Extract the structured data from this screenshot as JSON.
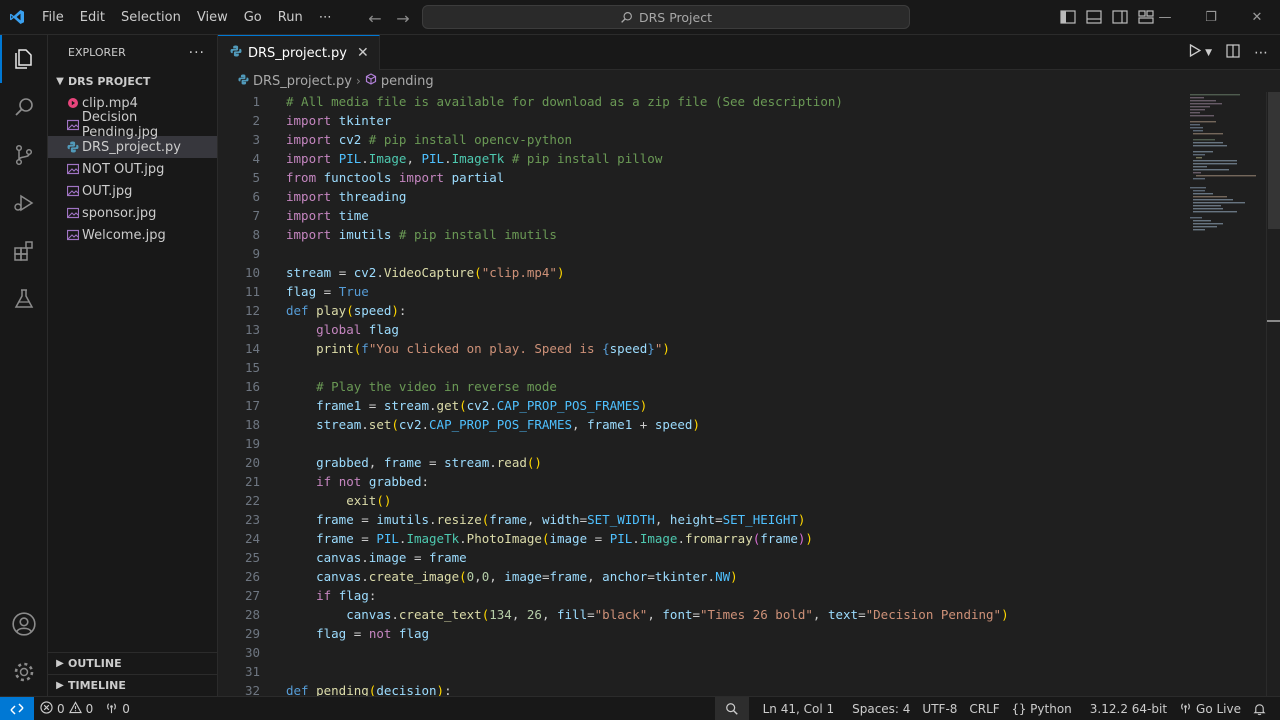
{
  "titlebar": {
    "menu": [
      "File",
      "Edit",
      "Selection",
      "View",
      "Go",
      "Run",
      "⋯"
    ],
    "search_text": "DRS Project"
  },
  "sidebar": {
    "title": "EXPLORER",
    "more": "···",
    "project": "DRS PROJECT",
    "files": [
      {
        "name": "clip.mp4",
        "type": "video"
      },
      {
        "name": "Decision Pending.jpg",
        "type": "image"
      },
      {
        "name": "DRS_project.py",
        "type": "python",
        "selected": true
      },
      {
        "name": "NOT OUT.jpg",
        "type": "image"
      },
      {
        "name": "OUT.jpg",
        "type": "image"
      },
      {
        "name": "sponsor.jpg",
        "type": "image"
      },
      {
        "name": "Welcome.jpg",
        "type": "image"
      }
    ],
    "outline": "OUTLINE",
    "timeline": "TIMELINE"
  },
  "editor": {
    "tab_label": "DRS_project.py",
    "breadcrumb_file": "DRS_project.py",
    "breadcrumb_symbol": "pending",
    "line_numbers": [
      "1",
      "2",
      "3",
      "4",
      "5",
      "6",
      "7",
      "8",
      "9",
      "10",
      "11",
      "12",
      "13",
      "14",
      "15",
      "16",
      "17",
      "18",
      "19",
      "20",
      "21",
      "22",
      "23",
      "24",
      "25",
      "26",
      "27",
      "28",
      "29",
      "30",
      "31",
      "32"
    ],
    "code": [
      "# All media file is available for download as a zip file (See description)",
      "import tkinter",
      "import cv2 # pip install opencv-python",
      "import PIL.Image, PIL.ImageTk # pip install pillow",
      "from functools import partial",
      "import threading",
      "import time",
      "import imutils # pip install imutils",
      "",
      "stream = cv2.VideoCapture(\"clip.mp4\")",
      "flag = True",
      "def play(speed):",
      "    global flag",
      "    print(f\"You clicked on play. Speed is {speed}\")",
      "",
      "    # Play the video in reverse mode",
      "    frame1 = stream.get(cv2.CAP_PROP_POS_FRAMES)",
      "    stream.set(cv2.CAP_PROP_POS_FRAMES, frame1 + speed)",
      "",
      "    grabbed, frame = stream.read()",
      "    if not grabbed:",
      "        exit()",
      "    frame = imutils.resize(frame, width=SET_WIDTH, height=SET_HEIGHT)",
      "    frame = PIL.ImageTk.PhotoImage(image = PIL.Image.fromarray(frame))",
      "    canvas.image = frame",
      "    canvas.create_image(0,0, image=frame, anchor=tkinter.NW)",
      "    if flag:",
      "        canvas.create_text(134, 26, fill=\"black\", font=\"Times 26 bold\", text=\"Decision Pending\")",
      "    flag = not flag",
      "",
      "",
      "def pending(decision):"
    ]
  },
  "statusbar": {
    "errors": "0",
    "warnings": "0",
    "ports": "0",
    "position": "Ln 41, Col 1",
    "spaces": "Spaces: 4",
    "encoding": "UTF-8",
    "eol": "CRLF",
    "language": "Python",
    "interpreter": "3.12.2 64-bit",
    "golive": "Go Live"
  },
  "colors": {
    "accent": "#0078d4",
    "keyword": "#c586c0",
    "comment": "#6a9955",
    "string": "#ce9178",
    "function": "#dcdcaa",
    "variable": "#9cdcfe"
  }
}
